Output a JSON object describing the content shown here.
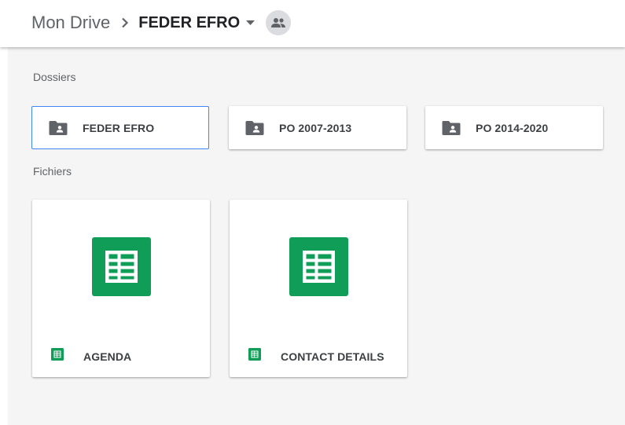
{
  "breadcrumb": {
    "root": "Mon Drive",
    "separator_icon": "chevron-right-icon",
    "current": "FEDER EFRO",
    "dropdown_icon": "caret-down-icon",
    "shared_icon": "people-icon"
  },
  "sections": {
    "folders_label": "Dossiers",
    "files_label": "Fichiers"
  },
  "folders": [
    {
      "name": "FEDER EFRO",
      "icon": "shared-folder-icon",
      "selected": true
    },
    {
      "name": "PO 2007-2013",
      "icon": "shared-folder-icon",
      "selected": false
    },
    {
      "name": "PO 2014-2020",
      "icon": "shared-folder-icon",
      "selected": false
    }
  ],
  "files": [
    {
      "name": "AGENDA",
      "type_icon": "google-sheets-icon"
    },
    {
      "name": "CONTACT DETAILS",
      "type_icon": "google-sheets-icon"
    }
  ],
  "colors": {
    "sheets_green": "#0f9d58",
    "selection_blue": "#4285f4",
    "folder_grey": "#5f6368",
    "content_bg": "#f5f5f5"
  }
}
